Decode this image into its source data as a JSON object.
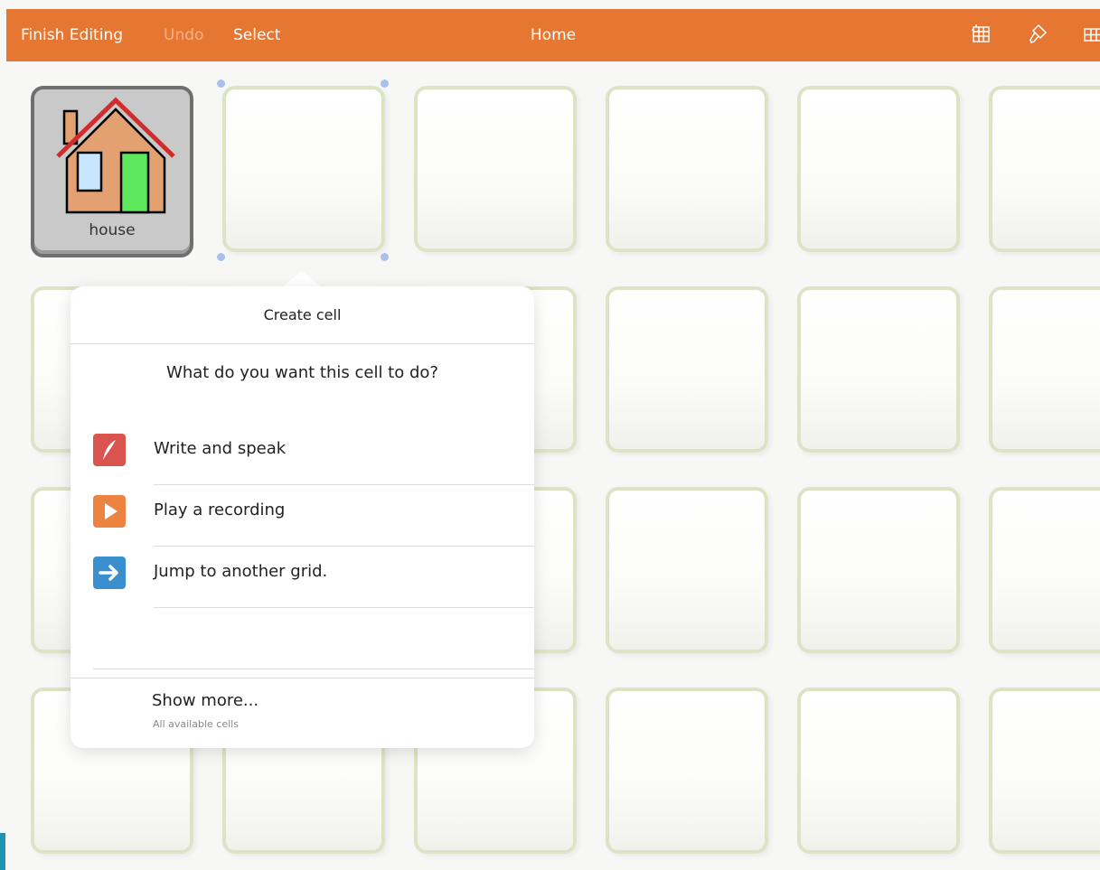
{
  "toolbar": {
    "finish_label": "Finish Editing",
    "undo_label": "Undo",
    "select_label": "Select",
    "title": "Home",
    "icons": [
      "grid-settings-icon",
      "paintbrush-icon",
      "grid-icon"
    ],
    "accent": "#e67732"
  },
  "grid": {
    "house_cell": {
      "label": "house",
      "icon": "house-icon"
    },
    "rows": 4,
    "columns": 6
  },
  "popover": {
    "title": "Create cell",
    "question": "What do you want this cell to do?",
    "options": [
      {
        "label": "Write and speak",
        "icon": "quill-icon",
        "color": "#d9534f"
      },
      {
        "label": "Play a recording",
        "icon": "play-icon",
        "color": "#ec8340"
      },
      {
        "label": "Jump to another grid.",
        "icon": "arrow-right-icon",
        "color": "#3a8fcf"
      }
    ],
    "more": {
      "label": "Show more...",
      "sublabel": "All available cells"
    }
  }
}
